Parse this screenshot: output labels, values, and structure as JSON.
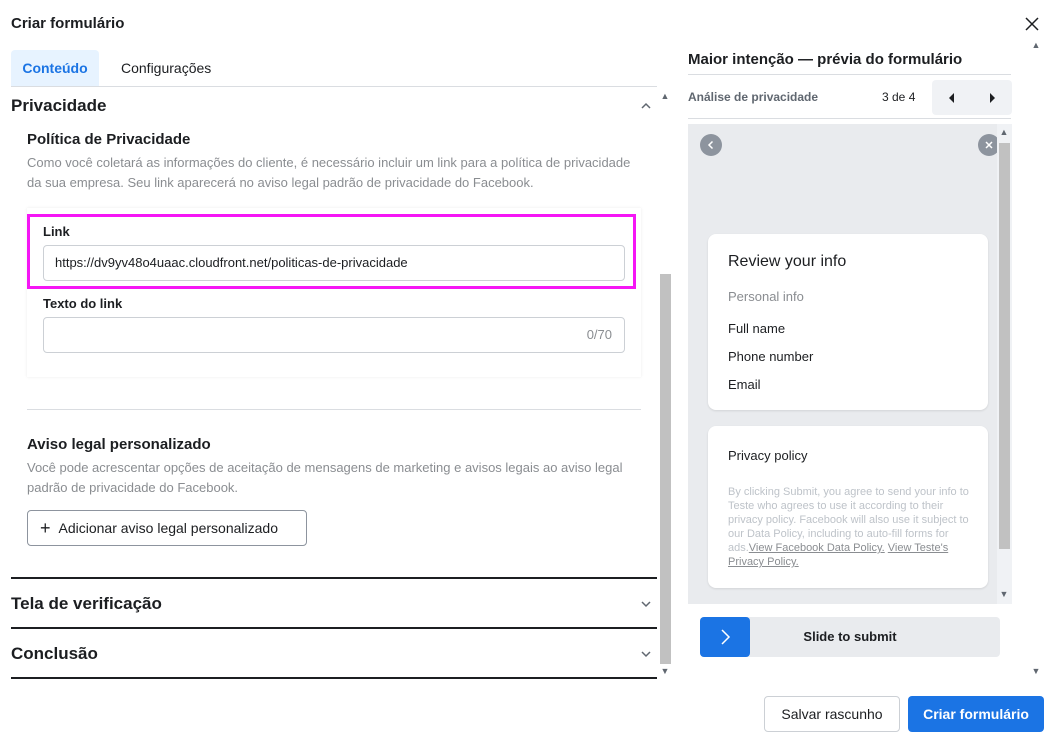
{
  "dialog": {
    "title": "Criar formulário"
  },
  "tabs": [
    {
      "label": "Conteúdo",
      "active": true
    },
    {
      "label": "Configurações",
      "active": false
    }
  ],
  "privacy_section": {
    "title": "Privacidade",
    "policy_title": "Política de Privacidade",
    "policy_description": "Como você coletará as informações do cliente, é necessário incluir um link para a política de privacidade da sua empresa. Seu link aparecerá no aviso legal padrão de privacidade do Facebook.",
    "link_label": "Link",
    "link_value": "https://dv9yv48o4uaac.cloudfront.net/politicas-de-privacidade",
    "link_text_label": "Texto do link",
    "link_text_value": "",
    "link_text_count": "0/70",
    "custom_disclaimer_title": "Aviso legal personalizado",
    "custom_disclaimer_description": "Você pode acrescentar opções de aceitação de mensagens de marketing e avisos legais ao aviso legal padrão de privacidade do Facebook.",
    "add_disclaimer_button": "Adicionar aviso legal personalizado"
  },
  "collapsed_sections": [
    {
      "title": "Tela de verificação"
    },
    {
      "title": "Conclusão"
    }
  ],
  "preview": {
    "title": "Maior intenção — prévia do formulário",
    "step_label": "Análise de privacidade",
    "step_count": "3 de 4",
    "review_card": {
      "heading": "Review your info",
      "subheading": "Personal info",
      "fields": [
        "Full name",
        "Phone number",
        "Email"
      ]
    },
    "privacy_card": {
      "heading": "Privacy policy",
      "legal_text": "By clicking Submit, you agree to send your info to Teste who agrees to use it according to their privacy policy. Facebook will also use it subject to our Data Policy, including to auto-fill forms for ads.",
      "link_1": "View Facebook Data Policy.",
      "link_2": "View Teste's Privacy Policy."
    },
    "slide_label": "Slide to submit"
  },
  "footer": {
    "save_draft": "Salvar rascunho",
    "create_form": "Criar formulário"
  },
  "colors": {
    "accent": "#1b74e4",
    "highlight": "#f516f5",
    "tab_active_bg": "#e7f3ff"
  }
}
